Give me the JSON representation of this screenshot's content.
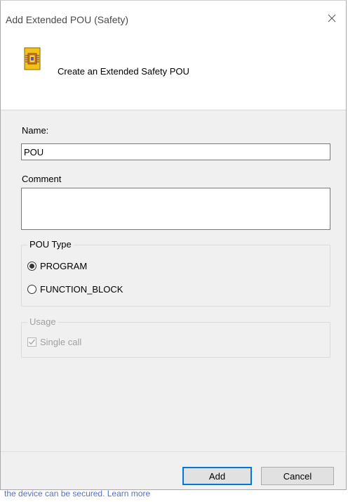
{
  "dialog": {
    "title": "Add Extended POU (Safety)",
    "header_text": "Create an Extended Safety POU",
    "header_icon": "safety-pou-icon",
    "close_icon": "close-icon"
  },
  "form": {
    "name_label": "Name:",
    "name_value": "POU",
    "comment_label": "Comment",
    "comment_value": ""
  },
  "pou_type": {
    "legend": "POU Type",
    "options": [
      {
        "label": "PROGRAM",
        "checked": true
      },
      {
        "label": "FUNCTION_BLOCK",
        "checked": false
      }
    ]
  },
  "usage": {
    "legend": "Usage",
    "single_call_label": "Single call",
    "single_call_checked": true,
    "enabled": false
  },
  "buttons": {
    "add_label": "Add",
    "cancel_label": "Cancel"
  },
  "backdrop": {
    "partial_text": "the device can be secured. Learn more"
  },
  "colors": {
    "dialog_bg": "#f0f0f0",
    "header_bg": "#ffffff",
    "accent": "#0078d7",
    "disabled_text": "#a0a0a0"
  }
}
